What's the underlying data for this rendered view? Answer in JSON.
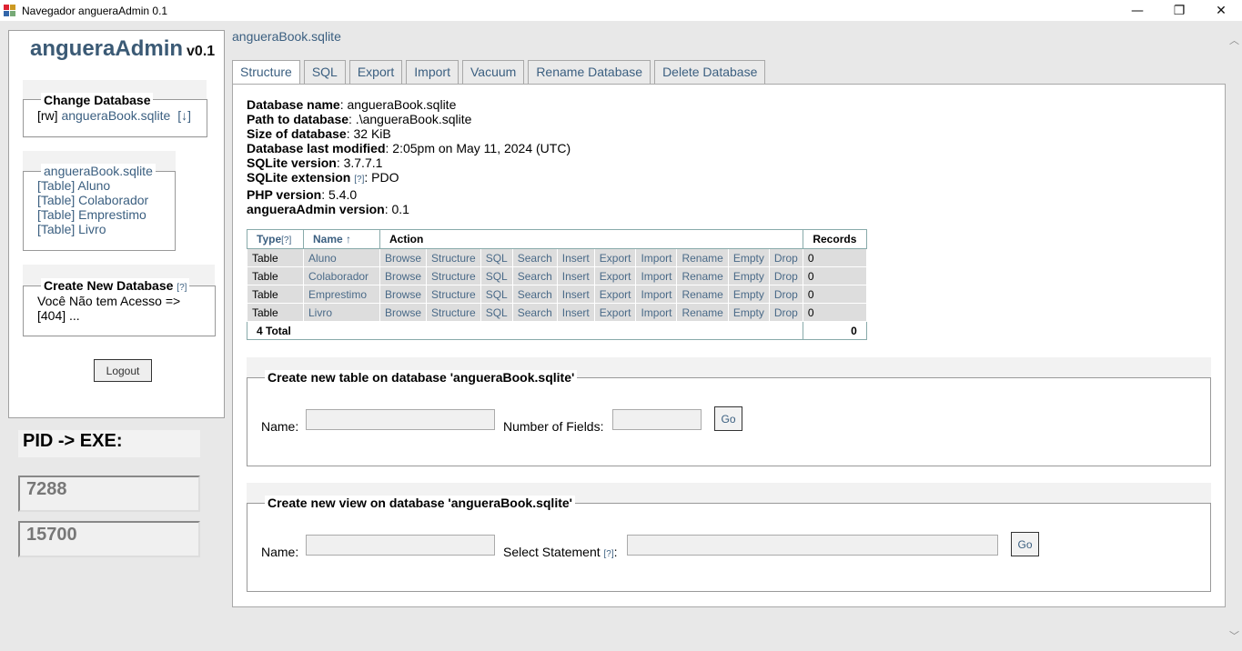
{
  "window": {
    "title": "Navegador angueraAdmin 0.1",
    "minimize": "—",
    "maximize": "❐",
    "close": "✕"
  },
  "sidebar": {
    "logo_name": "angueraAdmin",
    "logo_version": "v0.1",
    "change_db": {
      "legend": "Change Database",
      "mode": "[rw]",
      "db_name": "angueraBook.sqlite",
      "download": "[↓]"
    },
    "tables_box": {
      "legend": "angueraBook.sqlite",
      "items": [
        "[Table] Aluno",
        "[Table] Colaborador",
        "[Table] Emprestimo",
        "[Table] Livro"
      ]
    },
    "create_db": {
      "legend": "Create New Database",
      "help": "[?]",
      "line1": "Você Não tem Acesso =>",
      "line2": "[404] ..."
    },
    "logout": "Logout"
  },
  "pid": {
    "label": "PID -> EXE:",
    "values": [
      "7288",
      "15700"
    ]
  },
  "header": {
    "db_title": "angueraBook.sqlite"
  },
  "tabs": [
    "Structure",
    "SQL",
    "Export",
    "Import",
    "Vacuum",
    "Rename Database",
    "Delete Database"
  ],
  "info": [
    {
      "label": "Database name",
      "value": ": angueraBook.sqlite",
      "help": ""
    },
    {
      "label": "Path to database",
      "value": ": .\\angueraBook.sqlite",
      "help": ""
    },
    {
      "label": "Size of database",
      "value": ": 32 KiB",
      "help": ""
    },
    {
      "label": "Database last modified",
      "value": ": 2:05pm on May 11, 2024 (UTC)",
      "help": ""
    },
    {
      "label": "SQLite version",
      "value": ": 3.7.7.1",
      "help": ""
    },
    {
      "label": "SQLite extension",
      "value": ": PDO",
      "help": "[?]"
    },
    {
      "label": "PHP version",
      "value": ": 5.4.0",
      "help": ""
    },
    {
      "label": "angueraAdmin version",
      "value": ": 0.1",
      "help": ""
    }
  ],
  "table": {
    "headers": {
      "type": "Type",
      "type_help": "[?]",
      "name": "Name ↑",
      "action": "Action",
      "records": "Records"
    },
    "actions": [
      "Browse",
      "Structure",
      "SQL",
      "Search",
      "Insert",
      "Export",
      "Import",
      "Rename",
      "Empty",
      "Drop"
    ],
    "rows": [
      {
        "type": "Table",
        "name": "Aluno",
        "records": "0"
      },
      {
        "type": "Table",
        "name": "Colaborador",
        "records": "0"
      },
      {
        "type": "Table",
        "name": "Emprestimo",
        "records": "0"
      },
      {
        "type": "Table",
        "name": "Livro",
        "records": "0"
      }
    ],
    "total_label": "4 Total",
    "total_records": "0"
  },
  "create_table": {
    "legend": "Create new table on database 'angueraBook.sqlite'",
    "name_label": "Name:",
    "fields_label": "Number of Fields:",
    "go": "Go"
  },
  "create_view": {
    "legend": "Create new view on database 'angueraBook.sqlite'",
    "name_label": "Name:",
    "stmt_label": "Select Statement",
    "stmt_help": "[?]",
    "stmt_colon": ":",
    "go": "Go"
  },
  "scroll": {
    "up": "︿",
    "down": "﹀"
  }
}
